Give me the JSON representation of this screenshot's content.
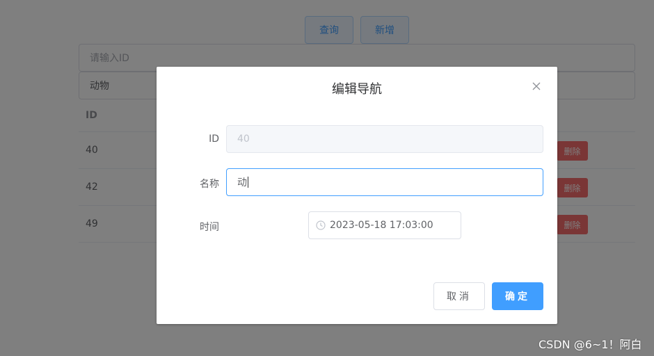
{
  "background": {
    "toolbar": {
      "query_label": "查询",
      "add_label": "新增"
    },
    "search": {
      "id_placeholder": "请输入ID",
      "name_value": "动物"
    },
    "table": {
      "header_id": "ID",
      "rows": [
        {
          "id": "40",
          "delete_label": "删除"
        },
        {
          "id": "42",
          "delete_label": "删除"
        },
        {
          "id": "49",
          "delete_label": "删除"
        }
      ]
    }
  },
  "dialog": {
    "title": "编辑导航",
    "close_icon": "close-icon",
    "fields": {
      "id": {
        "label": "ID",
        "value": "40"
      },
      "name": {
        "label": "名称",
        "value": "动"
      },
      "time": {
        "label": "时间",
        "value": "2023-05-18 17:03:00"
      }
    },
    "cancel_label": "取消",
    "confirm_label": "确定"
  },
  "watermark": "CSDN @6~1！阿白",
  "colors": {
    "primary": "#409eff",
    "danger": "#f56c6c",
    "overlay": "rgba(0,0,0,0.5)"
  }
}
